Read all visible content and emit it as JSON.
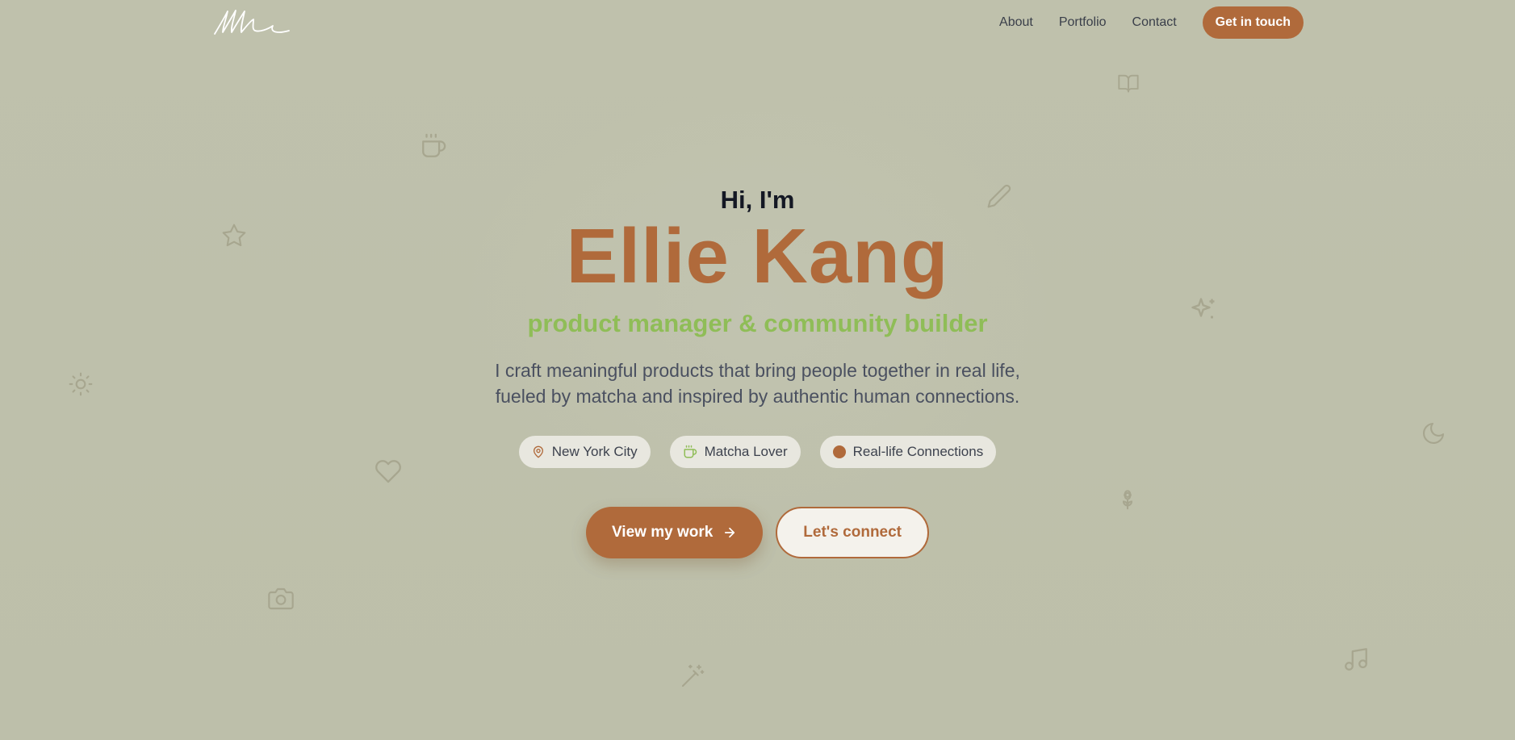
{
  "colors": {
    "background": "#bec0ab",
    "accent": "#b06a3b",
    "subtitle": "#8fbd57",
    "heading": "#141824",
    "body_text": "#4a5060",
    "tag_bg": "#e8e7df",
    "deco_icon": "#a7a68f"
  },
  "header": {
    "logo_icon": "signature-logo",
    "nav": [
      {
        "label": "About"
      },
      {
        "label": "Portfolio"
      },
      {
        "label": "Contact"
      }
    ],
    "cta_label": "Get in touch"
  },
  "hero": {
    "greeting": "Hi, I'm",
    "name": "Ellie Kang",
    "subtitle": "product manager & community builder",
    "description_lines": [
      "I craft meaningful products that bring people together in real life,",
      "fueled by matcha and inspired by authentic human connections."
    ],
    "tags": [
      {
        "label": "New York City",
        "icon": "map-pin-icon"
      },
      {
        "label": "Matcha Lover",
        "icon": "coffee-cup-icon"
      },
      {
        "label": "Real-life Connections",
        "icon": "dot-icon"
      }
    ],
    "primary_button": "View my work",
    "secondary_button": "Let's connect"
  },
  "decorative_icons": [
    "book-icon",
    "coffee-cup-icon",
    "pencil-icon",
    "star-icon",
    "sparkles-icon",
    "sun-icon",
    "moon-icon",
    "heart-icon",
    "flower-icon",
    "camera-icon",
    "magic-wand-icon",
    "music-note-icon"
  ]
}
